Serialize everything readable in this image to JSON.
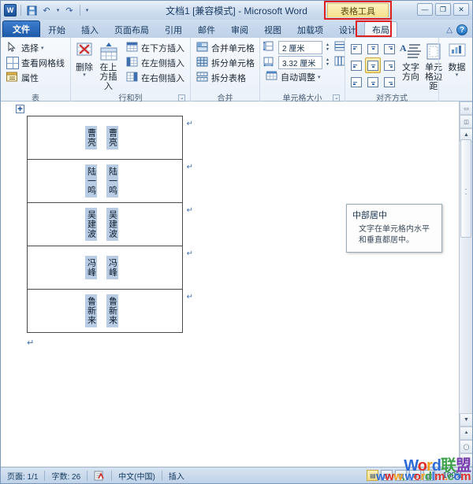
{
  "window": {
    "title": "文档1 [兼容模式] - Microsoft Word",
    "contextual_tab_tag": "表格工具",
    "qat": [
      {
        "name": "word-logo",
        "glyph": "W"
      },
      {
        "name": "save-icon",
        "glyph": "▣"
      },
      {
        "name": "undo-icon",
        "glyph": "↶"
      },
      {
        "name": "redo-icon",
        "glyph": "↷"
      },
      {
        "name": "customize-qat-icon",
        "glyph": "▾"
      }
    ],
    "buttons": {
      "minimize": "—",
      "restore": "❐",
      "close": "✕"
    }
  },
  "tabs": [
    {
      "label": "文件",
      "kind": "file"
    },
    {
      "label": "开始",
      "kind": "normal"
    },
    {
      "label": "插入",
      "kind": "normal"
    },
    {
      "label": "页面布局",
      "kind": "normal"
    },
    {
      "label": "引用",
      "kind": "normal"
    },
    {
      "label": "邮件",
      "kind": "normal"
    },
    {
      "label": "审阅",
      "kind": "normal"
    },
    {
      "label": "视图",
      "kind": "normal"
    },
    {
      "label": "加载项",
      "kind": "normal"
    },
    {
      "label": "设计",
      "kind": "normal"
    },
    {
      "label": "布局",
      "kind": "active"
    }
  ],
  "help": {
    "collapse_ribbon": "△",
    "help": "?"
  },
  "ribbon": {
    "groups": [
      {
        "name": "表",
        "label": "表",
        "small_items": [
          {
            "label": "选择",
            "icon": "select-arrow-icon",
            "has_caret": true
          },
          {
            "label": "查看网格线",
            "icon": "view-gridlines-icon",
            "has_caret": false
          },
          {
            "label": "属性",
            "icon": "table-properties-icon",
            "has_caret": false
          }
        ]
      },
      {
        "name": "行和列",
        "label": "行和列",
        "big_buttons": [
          {
            "label": "删除",
            "icon": "delete-table-icon",
            "has_caret": true
          },
          {
            "label": "在上方插入",
            "icon": "insert-above-icon",
            "has_caret": false
          }
        ],
        "small_items": [
          {
            "label": "在下方插入",
            "icon": "insert-below-icon"
          },
          {
            "label": "在左侧插入",
            "icon": "insert-left-icon"
          },
          {
            "label": "在右侧插入",
            "icon": "insert-right-icon"
          }
        ],
        "has_dialog_launcher": true
      },
      {
        "name": "合并",
        "label": "合并",
        "small_items": [
          {
            "label": "合并单元格",
            "icon": "merge-cells-icon"
          },
          {
            "label": "拆分单元格",
            "icon": "split-cells-icon"
          },
          {
            "label": "拆分表格",
            "icon": "split-table-icon"
          }
        ]
      },
      {
        "name": "单元格大小",
        "label": "单元格大小",
        "fields": [
          {
            "name": "row-height",
            "icon": "row-height-icon",
            "value": "2 厘米"
          },
          {
            "name": "column-width",
            "icon": "column-width-icon",
            "value": "3.32 厘米"
          }
        ],
        "small_items": [
          {
            "label": "自动调整",
            "icon": "autofit-icon",
            "has_caret": true
          }
        ],
        "side_buttons": [
          {
            "name": "distribute-rows-icon"
          },
          {
            "name": "distribute-columns-icon"
          }
        ],
        "has_dialog_launcher": true
      },
      {
        "name": "对齐方式",
        "label": "对齐方式",
        "align_grid": [
          {
            "name": "align-top-left",
            "selected": false
          },
          {
            "name": "align-top-center",
            "selected": false
          },
          {
            "name": "align-top-right",
            "selected": false
          },
          {
            "name": "align-middle-left",
            "selected": false
          },
          {
            "name": "align-middle-center",
            "selected": true
          },
          {
            "name": "align-middle-right",
            "selected": false
          },
          {
            "name": "align-bottom-left",
            "selected": false
          },
          {
            "name": "align-bottom-center",
            "selected": false
          },
          {
            "name": "align-bottom-right",
            "selected": false
          }
        ],
        "big_buttons": [
          {
            "label": "文字方向",
            "icon": "text-direction-icon",
            "has_caret": false
          },
          {
            "label": "单元格边距",
            "icon": "cell-margins-icon",
            "has_caret": false
          }
        ]
      },
      {
        "name": "数据",
        "label": "",
        "big_buttons": [
          {
            "label": "数据",
            "icon": "data-icon",
            "has_caret": true
          }
        ]
      }
    ]
  },
  "tooltip": {
    "title": "中部居中",
    "body": "文字在单元格内水平和垂直都居中。"
  },
  "document": {
    "table_move_handle": "✚",
    "rows": [
      {
        "col1": "曹亮",
        "col2": "曹亮"
      },
      {
        "col1": "陆一鸣",
        "col2": "陆一鸣"
      },
      {
        "col1": "吴建波",
        "col2": "吴建波"
      },
      {
        "col1": "冯峰",
        "col2": "冯峰"
      },
      {
        "col1": "鲁新来",
        "col2": "鲁新来"
      }
    ],
    "paragraph_mark": "↵",
    "row_end_mark": "↵"
  },
  "statusbar": {
    "page": "页面: 1/1",
    "words": "字数: 26",
    "proofing_icon": "proofing-errors-icon",
    "language": "中文(中国)",
    "insert_mode": "插入",
    "view_buttons": [
      {
        "name": "print-layout-view",
        "glyph": "▤",
        "active": true
      },
      {
        "name": "full-screen-reading-view",
        "glyph": "◫",
        "active": false
      },
      {
        "name": "web-layout-view",
        "glyph": "▧",
        "active": false
      },
      {
        "name": "outline-view",
        "glyph": "≣",
        "active": false
      },
      {
        "name": "draft-view",
        "glyph": "▥",
        "active": false
      }
    ],
    "zoom": "100%"
  },
  "watermark": {
    "line1": [
      "W",
      "o",
      "r",
      "d",
      "联",
      "盟"
    ],
    "line2": "www.wordlm.com"
  }
}
